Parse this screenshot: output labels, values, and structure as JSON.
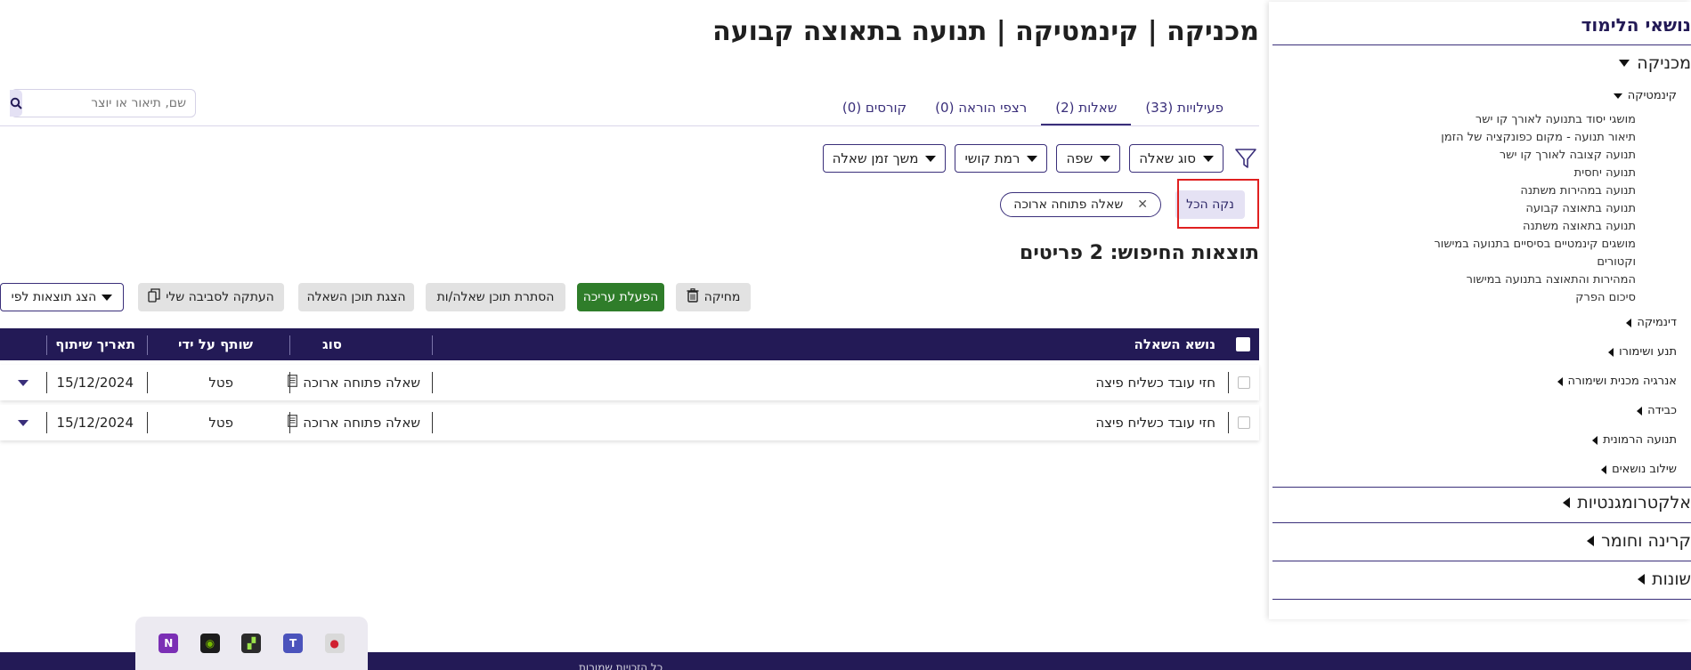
{
  "page_title": "מכניקה | קינמטיקה | תנועה בתאוצה קבועה",
  "tabs": [
    {
      "label": "פעילויות (33)",
      "active": false
    },
    {
      "label": "שאלות (2)",
      "active": true
    },
    {
      "label": "רצפי הוראה (0)",
      "active": false
    },
    {
      "label": "קורסים (0)",
      "active": false
    }
  ],
  "search": {
    "placeholder": "שם, תיאור או יוצר",
    "icon": "search-icon"
  },
  "filters": [
    "סוג שאלה",
    "שפה",
    "רמת קושי",
    "משך זמן שאלה"
  ],
  "clear_all": "נקה הכל",
  "active_chip": "שאלה פתוחה ארוכה",
  "chip_remove_glyph": "✕",
  "results_title": "תוצאות החיפוש: 2 פריטים",
  "actions": {
    "delete": "מחיקה",
    "enable_edit": "הפעלת עריכה",
    "hide_content": "הסתרת תוכן שאלה/ות",
    "show_content": "הצגת תוכן השאלה",
    "copy_env": "העתקה לסביבה שלי",
    "sort_by": "הצג תוצאות לפי"
  },
  "table": {
    "headers": {
      "subject": "נושא השאלה",
      "type": "סוג",
      "shared_by": "שותף על ידי",
      "date": "תאריך שיתוף"
    },
    "rows": [
      {
        "subject": "חזי עובד כשליח פיצה",
        "type": "שאלה פתוחה ארוכה",
        "shared_by": "פטל",
        "date": "15/12/2024"
      },
      {
        "subject": "חזי עובד כשליח פיצה",
        "type": "שאלה פתוחה ארוכה",
        "shared_by": "פטל",
        "date": "15/12/2024"
      }
    ]
  },
  "sidebar": {
    "title": "נושאי הלימוד",
    "mechanics": "מכניקה",
    "kinematics": "קינמטיקה",
    "kinematics_items": [
      "מושגי יסוד בתנועה לאורך קו ישר",
      "תיאור תנועה - מקום כפונקציה של הזמן",
      "תנועה קצובה לאורך קו ישר",
      "תנועה יחסית",
      "תנועה במהירות משתנה",
      "תנועה בתאוצה קבועה",
      "תנועה בתאוצה משתנה",
      "מושגים קינמטיים בסיסיים בתנועה במישור",
      "וקטורים",
      "המהירות והתאוצה בתנועה במישור",
      "סיכום הפרק"
    ],
    "mechanics_subs": [
      "דינמיקה",
      "תנע ושימורו",
      "אנרגיה מכנית ושימורה",
      "כבידה",
      "תנועה הרמונית",
      "שילוב נושאים"
    ],
    "majors": [
      "אלקטרומגנטיות",
      "קרינה וחומר",
      "שונות"
    ]
  },
  "footer_text": "כל הזכויות שמורות",
  "taskbar_icons": [
    "onenote-icon",
    "nvidia-icon",
    "terminal-icon",
    "teams-icon",
    "recorder-icon"
  ],
  "colors": {
    "primary": "#231a56",
    "accent": "#3a2f7a",
    "green": "#2f7d2a",
    "highlight": "#e02020"
  }
}
